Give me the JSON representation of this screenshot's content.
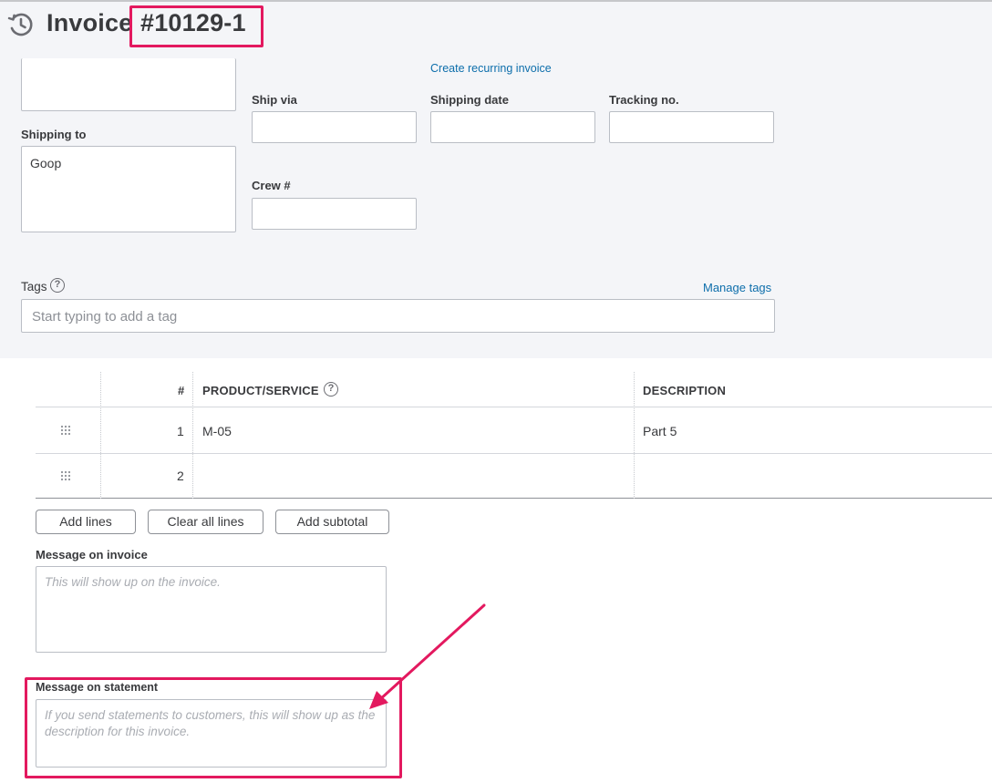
{
  "header": {
    "title": "Invoice",
    "number": "#10129-1",
    "history_icon": "history-clock-icon",
    "create_recurring_link": "Create recurring invoice"
  },
  "shipping": {
    "shipping_to_label": "Shipping to",
    "shipping_to_value": "Goop",
    "ship_via_label": "Ship via",
    "ship_via_value": "",
    "shipping_date_label": "Shipping date",
    "shipping_date_value": "",
    "tracking_label": "Tracking no.",
    "tracking_value": "",
    "crew_label": "Crew #",
    "crew_value": ""
  },
  "tags": {
    "label": "Tags",
    "help_icon": "question-circle-icon",
    "manage_link": "Manage tags",
    "placeholder": "Start typing to add a tag"
  },
  "table": {
    "headers": {
      "number": "#",
      "product": "PRODUCT/SERVICE",
      "description": "DESCRIPTION"
    },
    "rows": [
      {
        "number": "1",
        "product": "M-05",
        "description": "Part 5"
      },
      {
        "number": "2",
        "product": "",
        "description": ""
      }
    ]
  },
  "actions": {
    "add_lines": "Add lines",
    "clear_all_lines": "Clear all lines",
    "add_subtotal": "Add subtotal"
  },
  "messages": {
    "invoice_label": "Message on invoice",
    "invoice_placeholder": "This will show up on the invoice.",
    "statement_label": "Message on statement",
    "statement_placeholder": "If you send statements to customers, this will show up as the description for this invoice."
  },
  "colors": {
    "highlight": "#e3195f",
    "link": "#0d6eab",
    "band": "#f4f5f8"
  }
}
